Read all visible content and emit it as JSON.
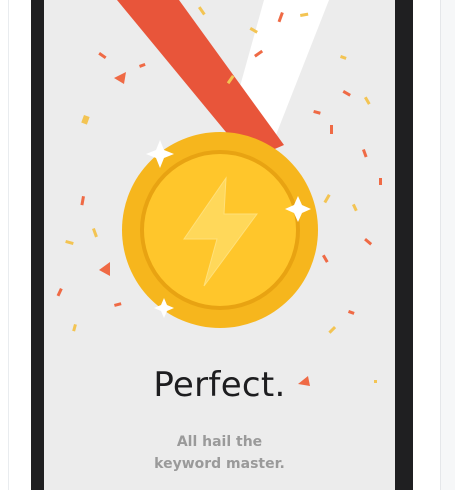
{
  "screen": {
    "title": "Perfect.",
    "subtitle_line1": "All hail the",
    "subtitle_line2": "keyword master."
  },
  "icons": {
    "medal": "medal-icon",
    "bolt": "lightning-bolt-icon"
  },
  "colors": {
    "ribbon_red": "#e8553a",
    "ribbon_white": "#ffffff",
    "medal_gold": "#f6b61d",
    "medal_inner": "#ffc62b",
    "bolt": "#ffd85a",
    "confetti_orange": "#ef6a45",
    "confetti_yellow": "#f3c453",
    "background": "#ececec"
  }
}
